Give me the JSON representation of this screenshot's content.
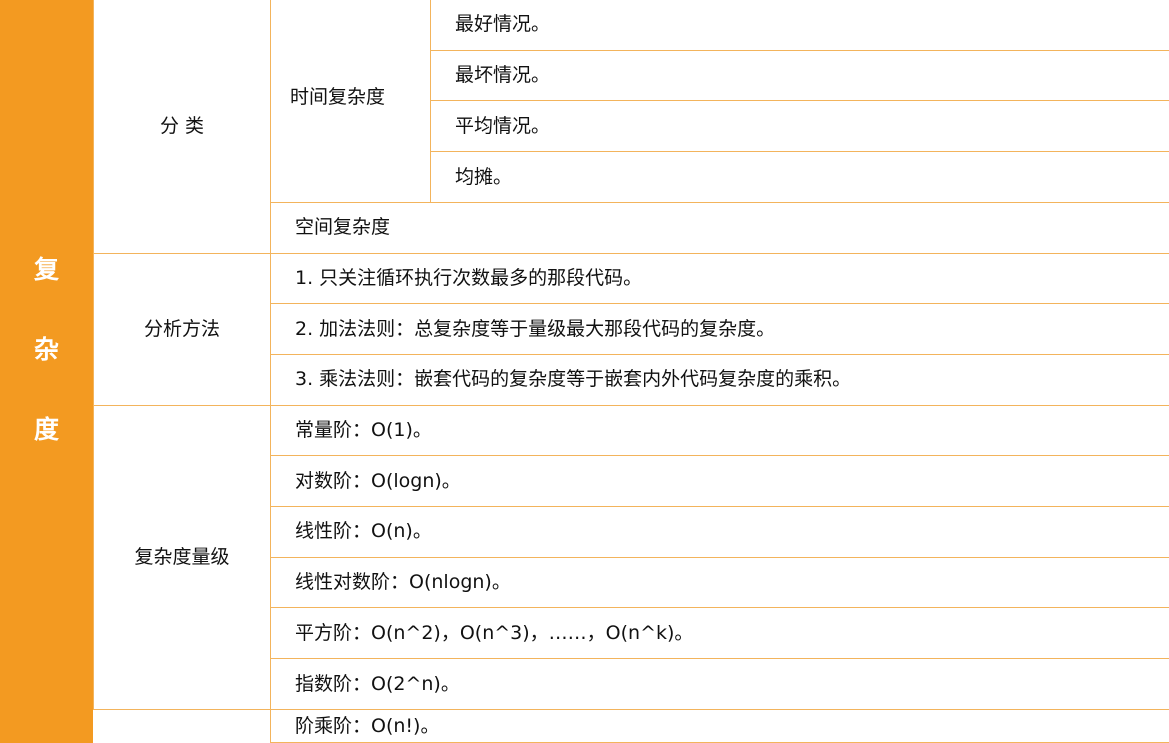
{
  "title_chars": [
    "复",
    "杂",
    "度"
  ],
  "categories": {
    "classification": "分 类",
    "analysis": "分析方法",
    "levels": "复杂度量级"
  },
  "time_complexity": {
    "label": "时间复杂度",
    "cases": [
      "最好情况。",
      "最坏情况。",
      "平均情况。",
      "均摊。"
    ]
  },
  "space_complexity": "空间复杂度",
  "analysis_methods": [
    "1. 只关注循环执行次数最多的那段代码。",
    "2. 加法法则：总复杂度等于量级最大那段代码的复杂度。",
    "3. 乘法法则：嵌套代码的复杂度等于嵌套内外代码复杂度的乘积。"
  ],
  "complexity_levels": [
    "常量阶：O(1)。",
    "对数阶：O(logn)。",
    "线性阶：O(n)。",
    "线性对数阶：O(nlogn)。",
    "平方阶：O(n^2)，O(n^3)，……，O(n^k)。",
    "指数阶：O(2^n)。",
    "阶乘阶：O(n!)。"
  ],
  "colors": {
    "accent": "#f39a21",
    "border": "#f3b45c"
  }
}
